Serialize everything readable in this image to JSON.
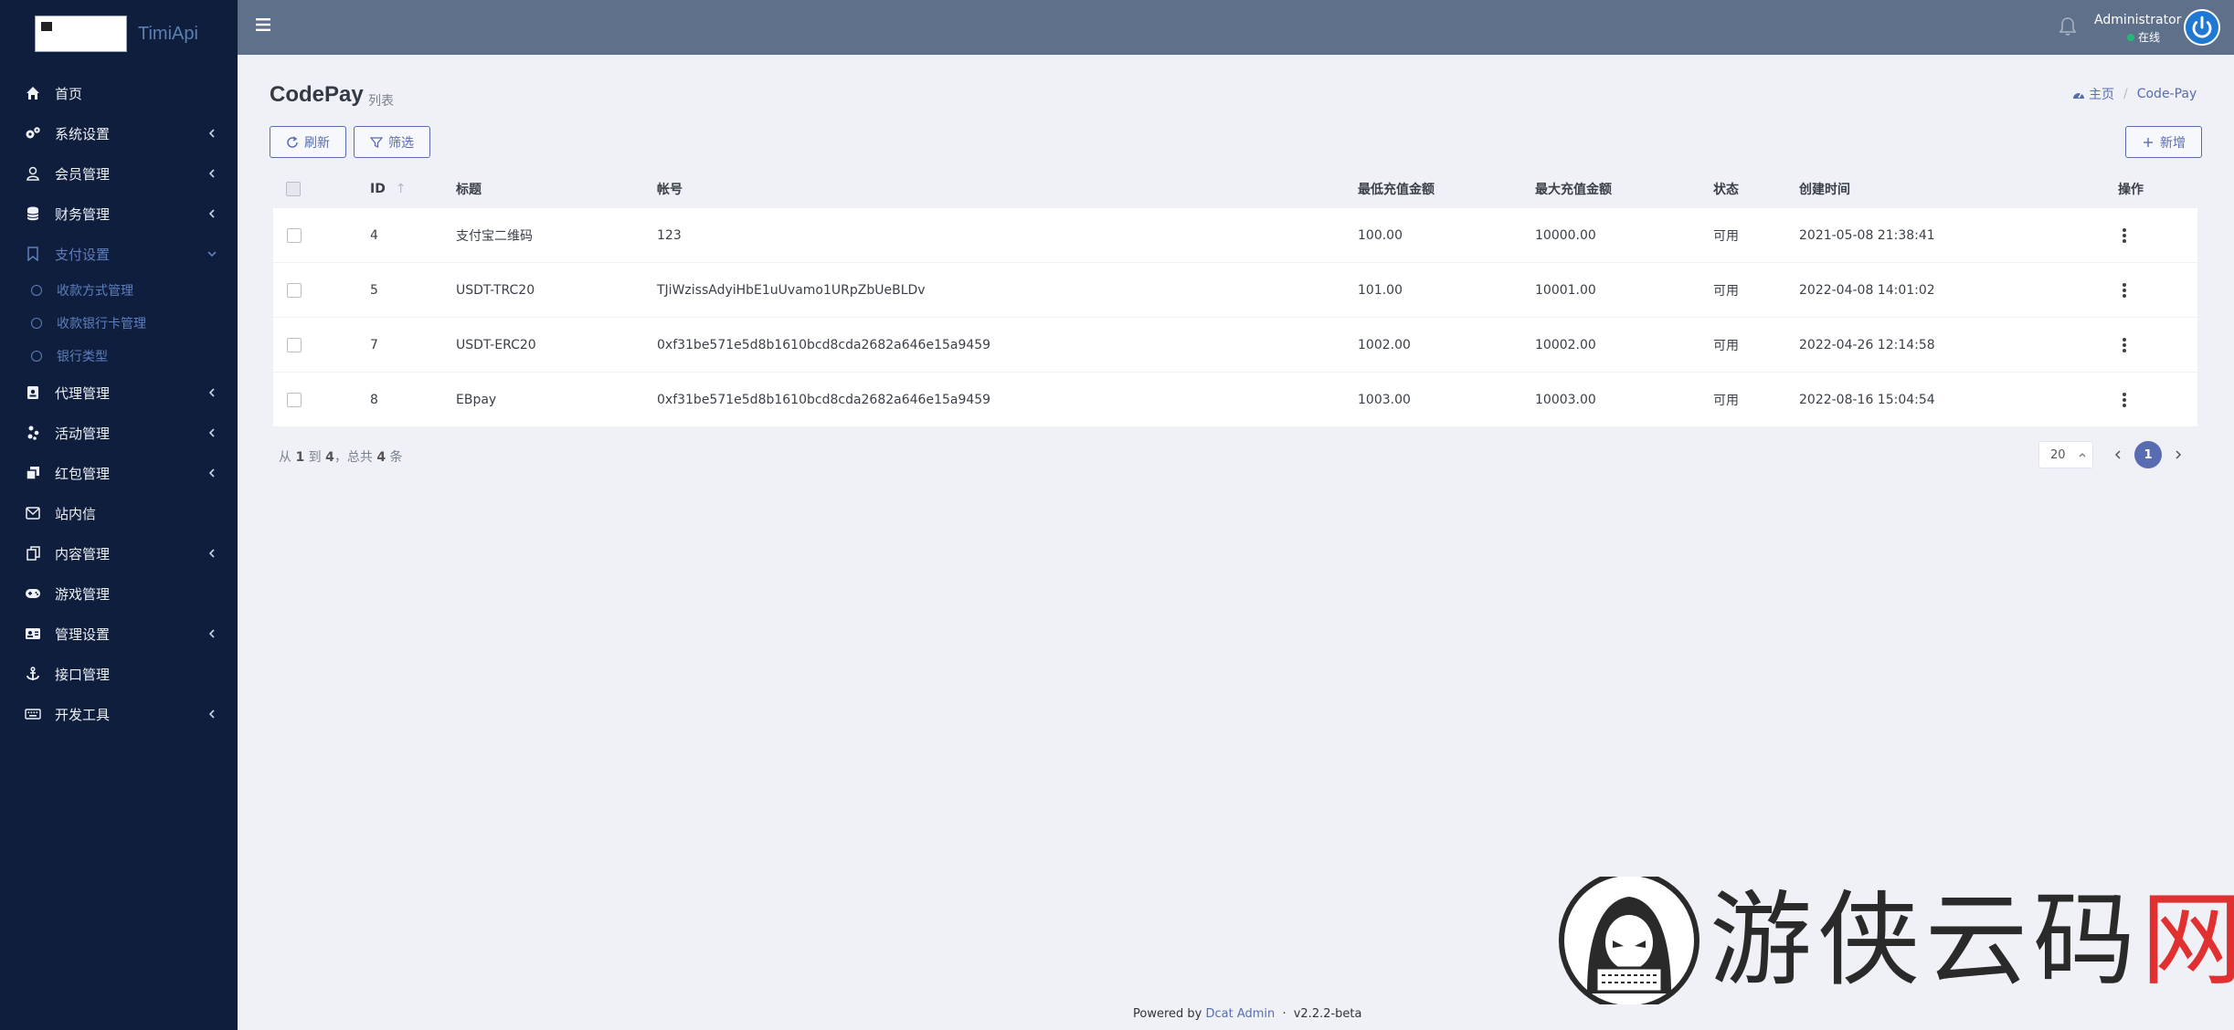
{
  "brand": {
    "name": "TimiApi"
  },
  "sidebar": {
    "items": [
      {
        "label": "首页",
        "icon": "home-icon",
        "has_children": false
      },
      {
        "label": "系统设置",
        "icon": "cogs-icon",
        "has_children": true
      },
      {
        "label": "会员管理",
        "icon": "user-icon",
        "has_children": true
      },
      {
        "label": "财务管理",
        "icon": "database-icon",
        "has_children": true
      },
      {
        "label": "支付设置",
        "icon": "bookmark-icon",
        "has_children": true,
        "open": true,
        "children": [
          {
            "label": "收款方式管理"
          },
          {
            "label": "收款银行卡管理"
          },
          {
            "label": "银行类型"
          }
        ]
      },
      {
        "label": "代理管理",
        "icon": "id-badge-icon",
        "has_children": true
      },
      {
        "label": "活动管理",
        "icon": "yelp-icon",
        "has_children": true
      },
      {
        "label": "红包管理",
        "icon": "clone-icon",
        "has_children": true
      },
      {
        "label": "站内信",
        "icon": "envelope-icon",
        "has_children": false
      },
      {
        "label": "内容管理",
        "icon": "copy-icon",
        "has_children": true
      },
      {
        "label": "游戏管理",
        "icon": "gamepad-icon",
        "has_children": false
      },
      {
        "label": "管理设置",
        "icon": "id-card-icon",
        "has_children": true
      },
      {
        "label": "接口管理",
        "icon": "anchor-icon",
        "has_children": false
      },
      {
        "label": "开发工具",
        "icon": "keyboard-icon",
        "has_children": true
      }
    ]
  },
  "header": {
    "user_name": "Administrator",
    "user_status": "在线"
  },
  "page": {
    "title": "CodePay",
    "subtitle": "列表",
    "breadcrumb": {
      "home": "主页",
      "current": "Code-Pay"
    }
  },
  "toolbar": {
    "refresh_label": "刷新",
    "filter_label": "筛选",
    "add_label": "新增"
  },
  "table": {
    "columns": {
      "id": "ID",
      "title": "标题",
      "account": "帐号",
      "min_amount": "最低充值金额",
      "max_amount": "最大充值金额",
      "status": "状态",
      "created_at": "创建时间",
      "actions": "操作"
    },
    "rows": [
      {
        "id": "4",
        "title": "支付宝二维码",
        "account": "123",
        "min_amount": "100.00",
        "max_amount": "10000.00",
        "status": "可用",
        "created_at": "2021-05-08 21:38:41"
      },
      {
        "id": "5",
        "title": "USDT-TRC20",
        "account": "TJiWzissAdyiHbE1uUvamo1URpZbUeBLDv",
        "min_amount": "101.00",
        "max_amount": "10001.00",
        "status": "可用",
        "created_at": "2022-04-08 14:01:02"
      },
      {
        "id": "7",
        "title": "USDT-ERC20",
        "account": "0xf31be571e5d8b1610bcd8cda2682a646e15a9459",
        "min_amount": "1002.00",
        "max_amount": "10002.00",
        "status": "可用",
        "created_at": "2022-04-26 12:14:58"
      },
      {
        "id": "8",
        "title": "EBpay",
        "account": "0xf31be571e5d8b1610bcd8cda2682a646e15a9459",
        "min_amount": "1003.00",
        "max_amount": "10003.00",
        "status": "可用",
        "created_at": "2022-08-16 15:04:54"
      }
    ]
  },
  "pagination": {
    "summary_prefix": "从",
    "from": "1",
    "summary_to": "到",
    "to": "4",
    "summary_total": "，总共",
    "total": "4",
    "summary_suffix": "条",
    "per_page": "20",
    "current_page": "1"
  },
  "footer": {
    "prefix": "Powered by",
    "link": "Dcat Admin",
    "sep": "·",
    "version": "v2.2.2-beta"
  },
  "watermark": {
    "text_main": "游侠云码",
    "text_accent": "网"
  },
  "colors": {
    "sidebar_bg": "#0f1e3d",
    "topbar_bg": "#5f708a",
    "primary": "#586cb1",
    "content_bg": "#eff1f7",
    "online": "#21b978"
  }
}
